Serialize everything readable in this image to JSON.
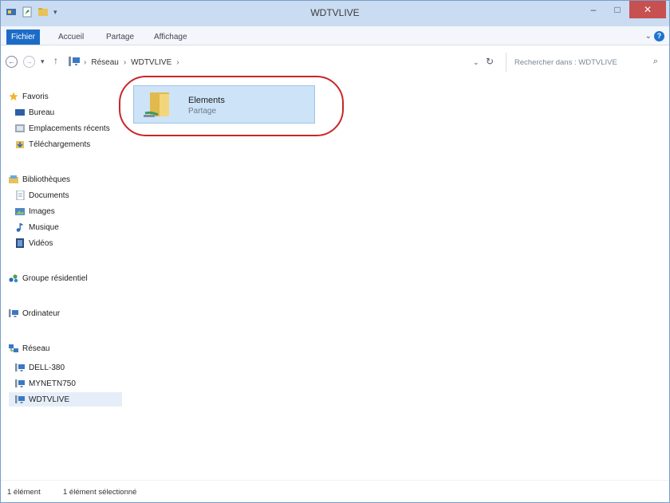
{
  "window": {
    "title": "WDTVLIVE",
    "minimize_glyph": "–",
    "maximize_glyph": "□",
    "close_glyph": "✕"
  },
  "ribbon": {
    "tabs": [
      "Fichier",
      "Accueil",
      "Partage",
      "Affichage"
    ],
    "expand_glyph": "⌄",
    "help_glyph": "?"
  },
  "address_bar": {
    "back_glyph": "←",
    "forward_glyph": "→",
    "recent_glyph": "▾",
    "up_glyph": "↑",
    "crumbs": [
      "Réseau",
      "WDTVLIVE"
    ],
    "separator": "›",
    "dropdown_glyph": "⌄",
    "refresh_glyph": "↻",
    "search_placeholder": "Rechercher dans : WDTVLIVE",
    "search_glyph": "⌕"
  },
  "navigation": {
    "items": [
      {
        "label": "Favoris",
        "icon": "star-icon"
      },
      {
        "label": "Bureau",
        "icon": "desktop-icon"
      },
      {
        "label": "Emplacements récents",
        "icon": "recent-places-icon"
      },
      {
        "label": "Téléchargements",
        "icon": "downloads-icon"
      },
      {
        "label": "Bibliothèques",
        "icon": "libraries-icon"
      },
      {
        "label": "Documents",
        "icon": "documents-icon"
      },
      {
        "label": "Images",
        "icon": "images-icon"
      },
      {
        "label": "Musique",
        "icon": "music-icon"
      },
      {
        "label": "Vidéos",
        "icon": "videos-icon"
      },
      {
        "label": "Groupe résidentiel",
        "icon": "homegroup-icon"
      },
      {
        "label": "Ordinateur",
        "icon": "computer-icon"
      },
      {
        "label": "Réseau",
        "icon": "network-icon"
      },
      {
        "label": "DELL-380",
        "icon": "computer-icon"
      },
      {
        "label": "MYNETN750",
        "icon": "computer-icon"
      },
      {
        "label": "WDTVLIVE",
        "icon": "computer-icon",
        "selected": true
      }
    ]
  },
  "content": {
    "items": [
      {
        "name": "Elements",
        "type": "Partage",
        "icon": "shared-folder-icon",
        "selected": true
      }
    ]
  },
  "status_bar": {
    "count": "1 élément",
    "selection": "1 élément sélectionné"
  },
  "colors": {
    "accent": "#1c6cc7",
    "selection": "#cde3f7",
    "highlight_ring": "#c8262a",
    "close_button": "#c75050"
  }
}
